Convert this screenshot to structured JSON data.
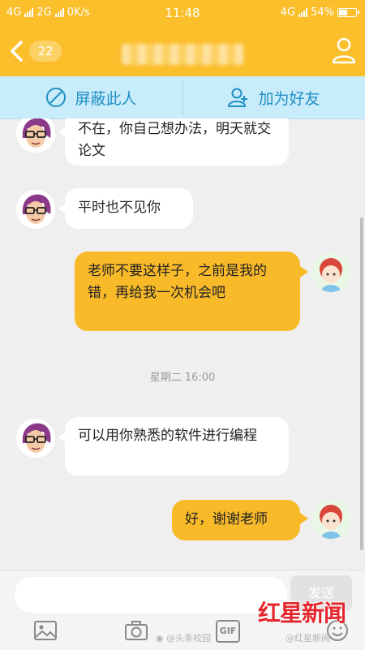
{
  "status": {
    "net1": "4G",
    "net2": "2G",
    "speed": "0K/s",
    "time": "11:48",
    "net3": "4G",
    "battery_percent_text": "54%",
    "battery_level": 0.54
  },
  "nav": {
    "badge": "22"
  },
  "actions": {
    "block_label": "屏蔽此人",
    "add_friend_label": "加为好友"
  },
  "messages": [
    {
      "side": "in",
      "text": "不在，你自己想办法，明天就交论文"
    },
    {
      "side": "in",
      "text": "平时也不见你"
    },
    {
      "side": "out",
      "text": "老师不要这样子，之前是我的错，再给我一次机会吧"
    },
    {
      "side": "in",
      "text": "可以用你熟悉的软件进行编程"
    },
    {
      "side": "out",
      "text": "好，谢谢老师"
    }
  ],
  "timestamp": "星期二 16:00",
  "input": {
    "send_label": "发送"
  },
  "toolbar": {
    "gif_label": "GIF"
  },
  "watermarks": {
    "weibo_left": "@头条校园",
    "weibo_right": "@红星新闻",
    "brand": "红星新闻"
  },
  "colors": {
    "accent": "#fbbf2c",
    "outgoing_bubble": "#f9ba2a",
    "action_bar": "#c9ecfb",
    "action_text": "#1f8fc4",
    "brand_red": "#e4262c"
  }
}
